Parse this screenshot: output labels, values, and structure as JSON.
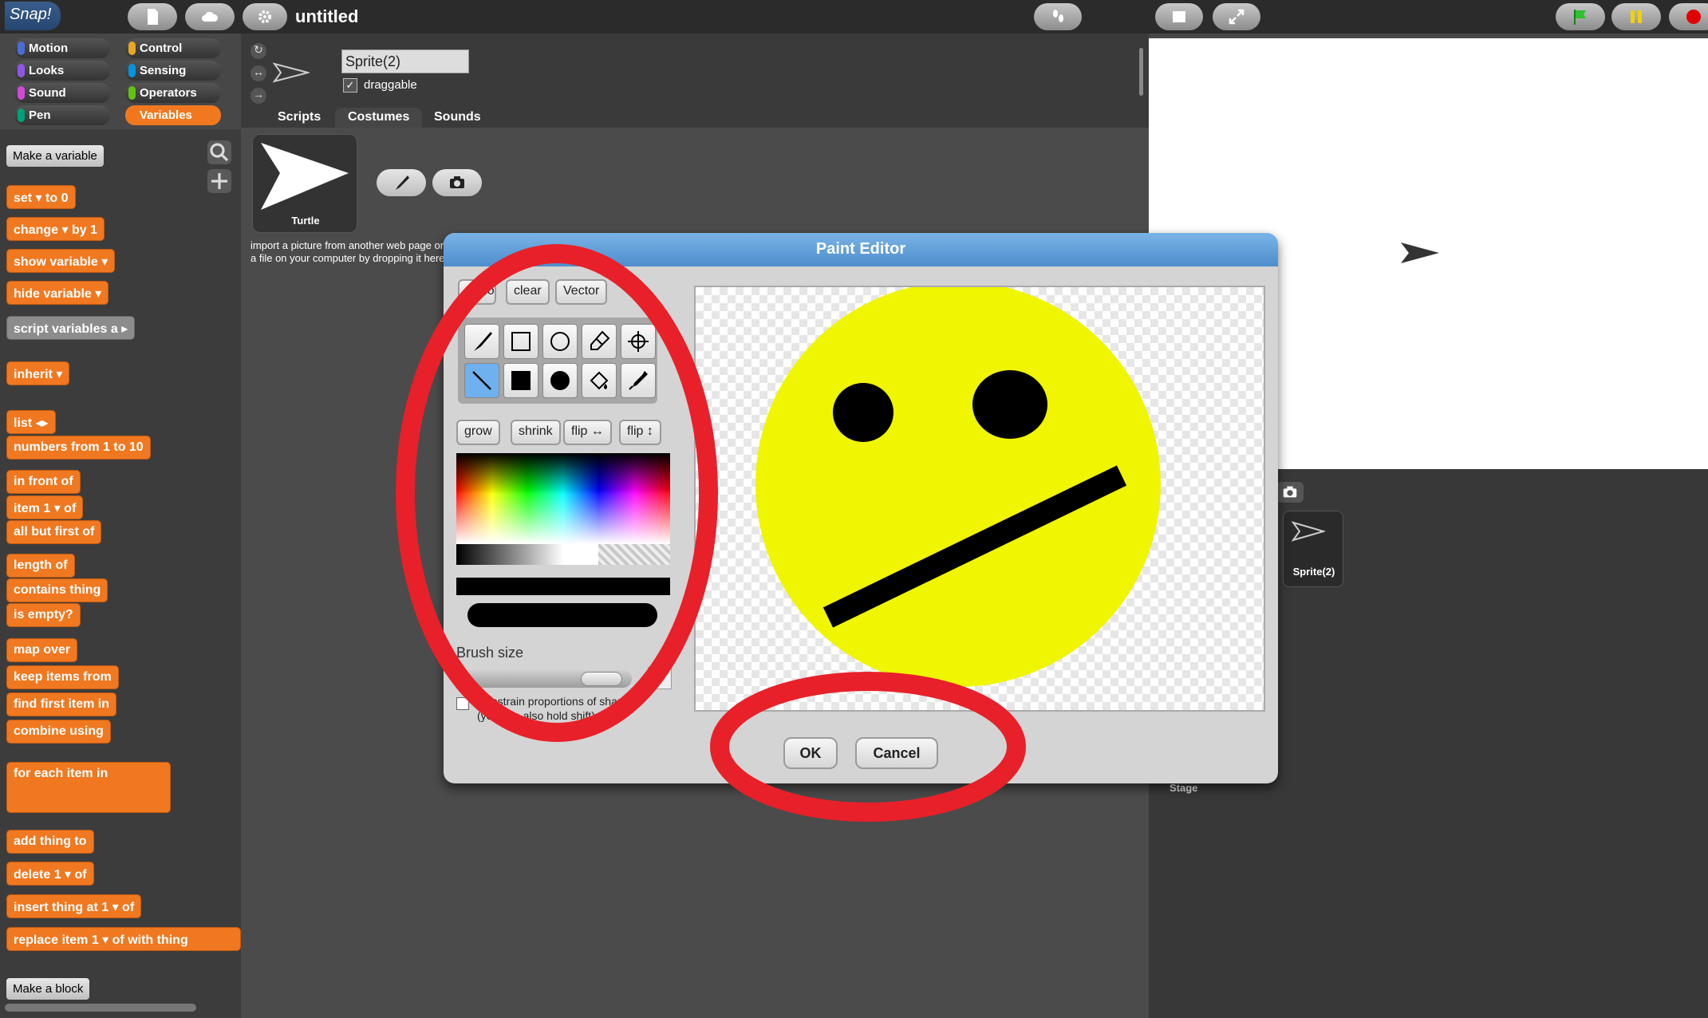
{
  "app": {
    "logo": "Snap!",
    "project_title": "untitled"
  },
  "categories": [
    {
      "label": "Motion",
      "color": "#4a6cd4"
    },
    {
      "label": "Control",
      "color": "#e6a822"
    },
    {
      "label": "Looks",
      "color": "#8f56e3"
    },
    {
      "label": "Sensing",
      "color": "#0494dc"
    },
    {
      "label": "Sound",
      "color": "#cf4ad9"
    },
    {
      "label": "Operators",
      "color": "#62c213"
    },
    {
      "label": "Pen",
      "color": "#00a178"
    },
    {
      "label": "Variables",
      "color": "#f3761d"
    }
  ],
  "palette": {
    "make_variable": "Make a variable",
    "make_block": "Make a block",
    "blocks": [
      "set ▾ to 0",
      "change ▾ by 1",
      "show variable ▾",
      "hide variable ▾",
      "script variables a ▸",
      "inherit ▾",
      "list ◂▸",
      "numbers from 1 to 10",
      "in front of",
      "item 1 ▾ of",
      "all but first of",
      "length of",
      "contains thing",
      "is empty?",
      "map over",
      "keep items from",
      "find first item in",
      "combine using",
      "for each item in",
      "add thing to",
      "delete 1 ▾ of",
      "insert thing at 1 ▾ of",
      "replace item 1 ▾ of with thing"
    ]
  },
  "sprite": {
    "name": "Sprite(2)",
    "draggable_label": "draggable",
    "draggable": true
  },
  "tabs": [
    "Scripts",
    "Costumes",
    "Sounds"
  ],
  "costume": {
    "name": "Turtle",
    "import_hint_1": "import a picture from another web page or from",
    "import_hint_2": "a file on your computer by dropping it here"
  },
  "paint_editor": {
    "title": "Paint Editor",
    "undo": "undo",
    "clear": "clear",
    "vector": "Vector",
    "grow": "grow",
    "shrink": "shrink",
    "flip_h": "flip ↔",
    "flip_v": "flip ↕",
    "brush_size_label": "Brush size",
    "brush_size_value": "20",
    "constrain_1": "Constrain proportions of shapes?",
    "constrain_2": "(you can also hold shift)",
    "ok": "OK",
    "cancel": "Cancel",
    "tools": [
      "brush-icon",
      "rectangle-icon",
      "ellipse-icon",
      "eraser-icon",
      "crosshairs-icon",
      "line-icon",
      "filled-rectangle-icon",
      "filled-ellipse-icon",
      "paint-bucket-icon",
      "eyedropper-icon"
    ],
    "selected_tool": "line-icon",
    "colors": {
      "face": "#f0f500",
      "features": "#000000",
      "annotation": "#e8202a"
    }
  },
  "corral": {
    "sprite_label": "Sprite(2)",
    "stage_label": "Stage"
  }
}
